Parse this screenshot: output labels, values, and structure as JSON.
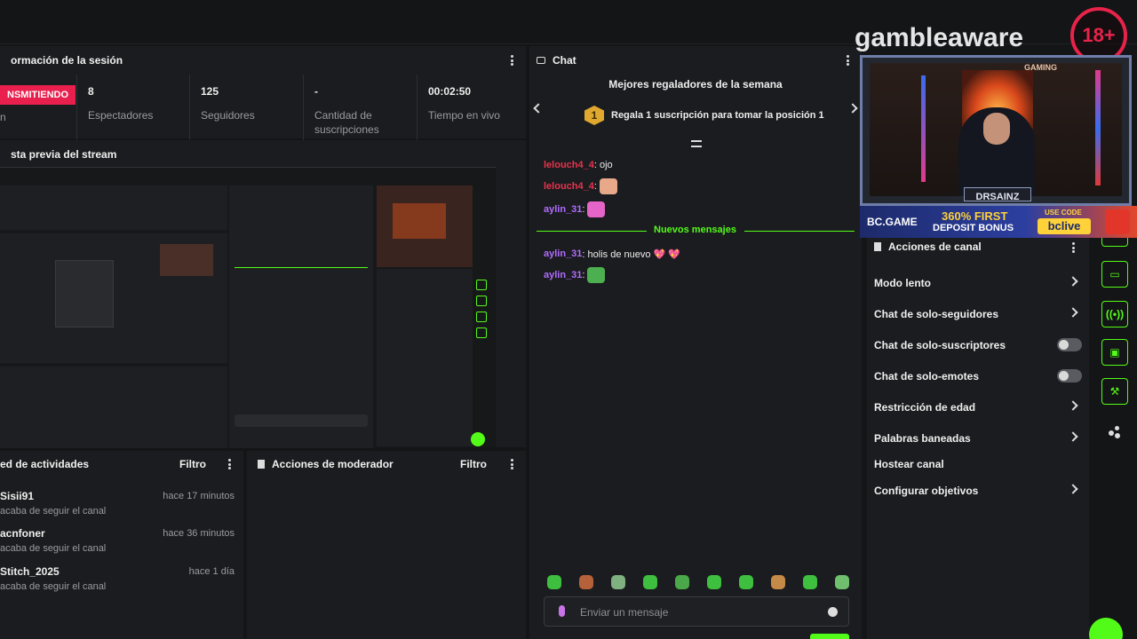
{
  "session": {
    "title": "ormación de la sesión",
    "live_badge": "NSMITIENDO",
    "live_sub": "n",
    "stats": [
      {
        "value": "8",
        "label": "Espectadores"
      },
      {
        "value": "125",
        "label": "Seguidores"
      },
      {
        "value": "-",
        "label": "Cantidad de suscripciones"
      },
      {
        "value": "00:02:50",
        "label": "Tiempo en vivo"
      }
    ]
  },
  "preview": {
    "title": "sta previa del stream"
  },
  "activity": {
    "title": "ed de actividades",
    "filter": "Filtro",
    "items": [
      {
        "name": "Sisii91",
        "time": "hace 17 minutos",
        "desc": "acaba de seguir el canal"
      },
      {
        "name": "acnfoner",
        "time": "hace 36 minutos",
        "desc": "acaba de seguir el canal"
      },
      {
        "name": "Stitch_2025",
        "time": "hace 1 día",
        "desc": "acaba de seguir el canal"
      }
    ]
  },
  "moderator": {
    "title": "Acciones de moderador",
    "filter": "Filtro"
  },
  "chat": {
    "title": "Chat",
    "gifters_title": "Mejores regaladores de la semana",
    "gifters_rank": "1",
    "gifters_text": "Regala 1 suscripción para tomar la posición 1",
    "messages_before": [
      {
        "user": "lelouch4_4",
        "text": ": ojo",
        "color": "#e8324d"
      },
      {
        "user": "lelouch4_4",
        "text": ":",
        "color": "#e8324d"
      },
      {
        "user": "aylin_31",
        "text": ":",
        "color": "#b06cff"
      }
    ],
    "new_messages_label": "Nuevos mensajes",
    "messages_after": [
      {
        "user": "aylin_31",
        "text": ": holis de nuevo 💖 💖",
        "color": "#b06cff"
      },
      {
        "user": "aylin_31",
        "text": ":",
        "color": "#b06cff"
      }
    ],
    "input_placeholder": "Enviar un mensaje"
  },
  "overlay": {
    "brand": "gambleaware",
    "age": "18+",
    "cam_name": "DRSAINZ",
    "sponsor": "BC.GAME",
    "promo_line1": "360% FIRST",
    "promo_line2": "DEPOSIT BONUS",
    "use_code": "USE CODE",
    "code": "bclive",
    "gaming": "GAMING"
  },
  "channel_actions": {
    "title": "Acciones de canal",
    "items": [
      {
        "label": "Modo lento",
        "control": "chevron"
      },
      {
        "label": "Chat de solo-seguidores",
        "control": "chevron"
      },
      {
        "label": "Chat de solo-suscriptores",
        "control": "toggle"
      },
      {
        "label": "Chat de solo-emotes",
        "control": "toggle"
      },
      {
        "label": "Restricción de edad",
        "control": "chevron"
      },
      {
        "label": "Palabras baneadas",
        "control": "chevron"
      },
      {
        "label": "Hostear canal",
        "control": "none"
      },
      {
        "label": "Configurar objetivos",
        "control": "chevron"
      }
    ]
  },
  "colors": {
    "accent": "#53fc18",
    "live": "#e91f4e",
    "panel": "#1b1c1f",
    "background": "#141517"
  }
}
